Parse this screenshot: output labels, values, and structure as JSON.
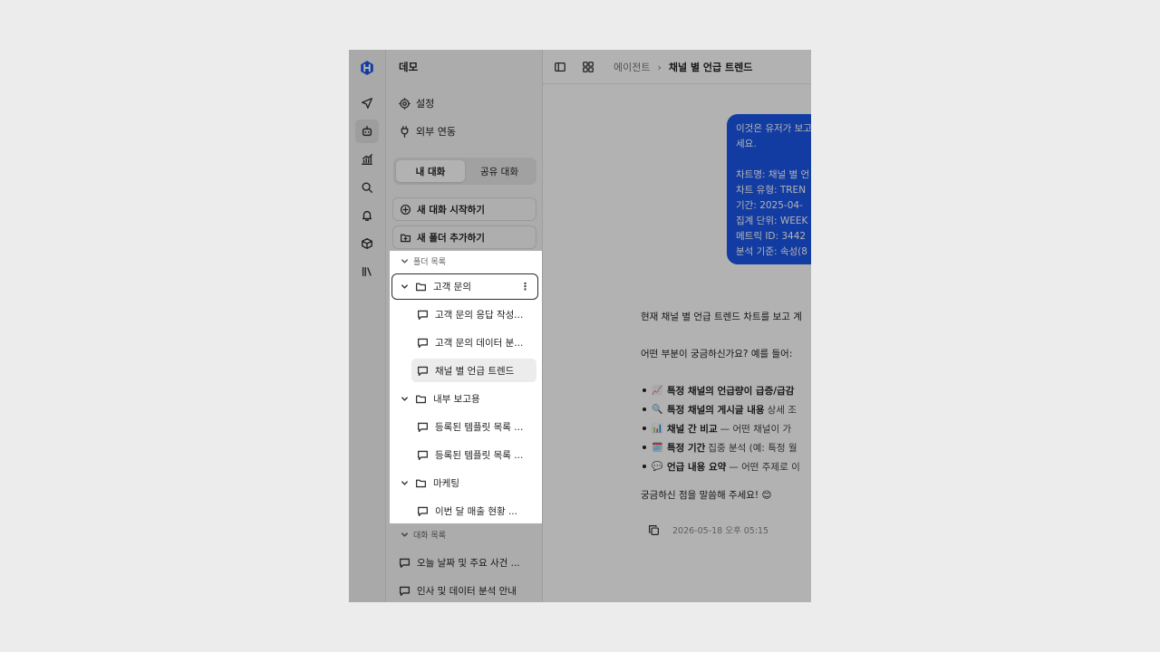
{
  "sidebar": {
    "workspace_title": "데모",
    "links": {
      "settings": "설정",
      "integrations": "외부 연동"
    },
    "tabs": {
      "mine": "내 대화",
      "shared": "공유 대화"
    },
    "actions": {
      "new_chat": "새 대화 시작하기",
      "new_folder": "새 폴더 추가하기"
    },
    "folder_section": "폴더 목록",
    "folders": [
      {
        "name": "고객 문의",
        "chats": [
          "고객 문의 응답 작성...",
          "고객 문의 데이터 분...",
          "채널 별 언급 트렌드"
        ]
      },
      {
        "name": "내부 보고용",
        "chats": [
          "등록된 템플릿 목록 ...",
          "등록된 템플릿 목록 ..."
        ]
      },
      {
        "name": "마케팅",
        "chats": [
          "이번 달 매출 현황 ..."
        ]
      }
    ],
    "conversation_section": "대화 목록",
    "conversations": [
      "오늘 날짜 및 주요 사건 ...",
      "인사 및 데이터 분석 안내"
    ]
  },
  "breadcrumb": {
    "parent": "에이전트",
    "separator": "›",
    "current": "채널 별 언급 트렌드"
  },
  "user_message": {
    "lines": [
      "이것은 유저가 보고",
      "세요."
    ],
    "details": [
      "차트명: 채널 별 언",
      "차트 유형: TREN",
      "기간: 2025-04-",
      "집계 단위: WEEK",
      "메트릭 ID: 3442",
      "분석 기준: 속성(8"
    ]
  },
  "assistant": {
    "intro": "현재 채널 별 언급 트렌드 차트를 보고 계",
    "question": "어떤 부분이 궁금하신가요? 예를 들어:",
    "bullets": [
      {
        "emoji": "📈",
        "bold": "특정 채널의 언급량이 급증/급감",
        "normal": ""
      },
      {
        "emoji": "🔍",
        "bold": "특정 채널의 게시글 내용",
        "normal": "상세 조"
      },
      {
        "emoji": "📊",
        "bold": "채널 간 비교",
        "normal": "— 어떤 채널이 가"
      },
      {
        "emoji": "🗓️",
        "bold": "특정 기간",
        "normal": "집중 분석 (예: 특정 월"
      },
      {
        "emoji": "💬",
        "bold": "언급 내용 요약",
        "normal": "— 어떤 주제로 이"
      }
    ],
    "closing": "궁금하신 점을 말씀해 주세요! 😊",
    "timestamp": "2026-05-18 오후 05:15"
  },
  "colors": {
    "accent": "#1a56e8",
    "overlay": "rgba(0,0,0,0.30)"
  }
}
